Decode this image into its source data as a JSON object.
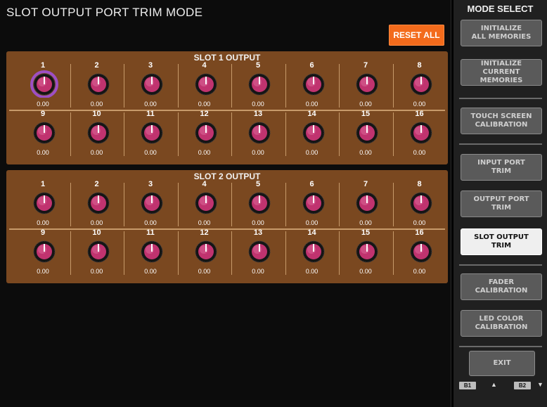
{
  "page": {
    "title": "SLOT OUTPUT PORT TRIM MODE",
    "reset_label": "RESET ALL"
  },
  "slots": [
    {
      "title": "SLOT 1 OUTPUT",
      "channels": [
        {
          "num": "1",
          "val": "0.00",
          "selected": true
        },
        {
          "num": "2",
          "val": "0.00"
        },
        {
          "num": "3",
          "val": "0.00"
        },
        {
          "num": "4",
          "val": "0.00"
        },
        {
          "num": "5",
          "val": "0.00"
        },
        {
          "num": "6",
          "val": "0.00"
        },
        {
          "num": "7",
          "val": "0.00"
        },
        {
          "num": "8",
          "val": "0.00"
        },
        {
          "num": "9",
          "val": "0.00"
        },
        {
          "num": "10",
          "val": "0.00"
        },
        {
          "num": "11",
          "val": "0.00"
        },
        {
          "num": "12",
          "val": "0.00"
        },
        {
          "num": "13",
          "val": "0.00"
        },
        {
          "num": "14",
          "val": "0.00"
        },
        {
          "num": "15",
          "val": "0.00"
        },
        {
          "num": "16",
          "val": "0.00"
        }
      ]
    },
    {
      "title": "SLOT 2 OUTPUT",
      "channels": [
        {
          "num": "1",
          "val": "0.00"
        },
        {
          "num": "2",
          "val": "0.00"
        },
        {
          "num": "3",
          "val": "0.00"
        },
        {
          "num": "4",
          "val": "0.00"
        },
        {
          "num": "5",
          "val": "0.00"
        },
        {
          "num": "6",
          "val": "0.00"
        },
        {
          "num": "7",
          "val": "0.00"
        },
        {
          "num": "8",
          "val": "0.00"
        },
        {
          "num": "9",
          "val": "0.00"
        },
        {
          "num": "10",
          "val": "0.00"
        },
        {
          "num": "11",
          "val": "0.00"
        },
        {
          "num": "12",
          "val": "0.00"
        },
        {
          "num": "13",
          "val": "0.00"
        },
        {
          "num": "14",
          "val": "0.00"
        },
        {
          "num": "15",
          "val": "0.00"
        },
        {
          "num": "16",
          "val": "0.00"
        }
      ]
    }
  ],
  "mode_select": {
    "title": "MODE SELECT",
    "buttons": [
      {
        "label": "INITIALIZE\nALL MEMORIES",
        "name": "initialize-all-memories-button"
      },
      {
        "label": "INITIALIZE\nCURRENT MEMORIES",
        "name": "initialize-current-memories-button"
      },
      {
        "label": "TOUCH SCREEN\nCALIBRATION",
        "name": "touch-screen-calibration-button"
      },
      {
        "label": "INPUT PORT\nTRIM",
        "name": "input-port-trim-button"
      },
      {
        "label": "OUTPUT PORT\nTRIM",
        "name": "output-port-trim-button"
      },
      {
        "label": "SLOT OUTPUT\nTRIM",
        "name": "slot-output-trim-button",
        "active": true
      },
      {
        "label": "FADER\nCALIBRATION",
        "name": "fader-calibration-button"
      },
      {
        "label": "LED COLOR\nCALIBRATION",
        "name": "led-color-calibration-button"
      },
      {
        "label": "EXIT",
        "name": "exit-button"
      }
    ],
    "banks": [
      "B1",
      "B2"
    ]
  },
  "colors": {
    "panel": "#7a4820",
    "knob": "#c0336f",
    "accent": "#f36b1c",
    "selected_ring": "#9d4fc4"
  }
}
